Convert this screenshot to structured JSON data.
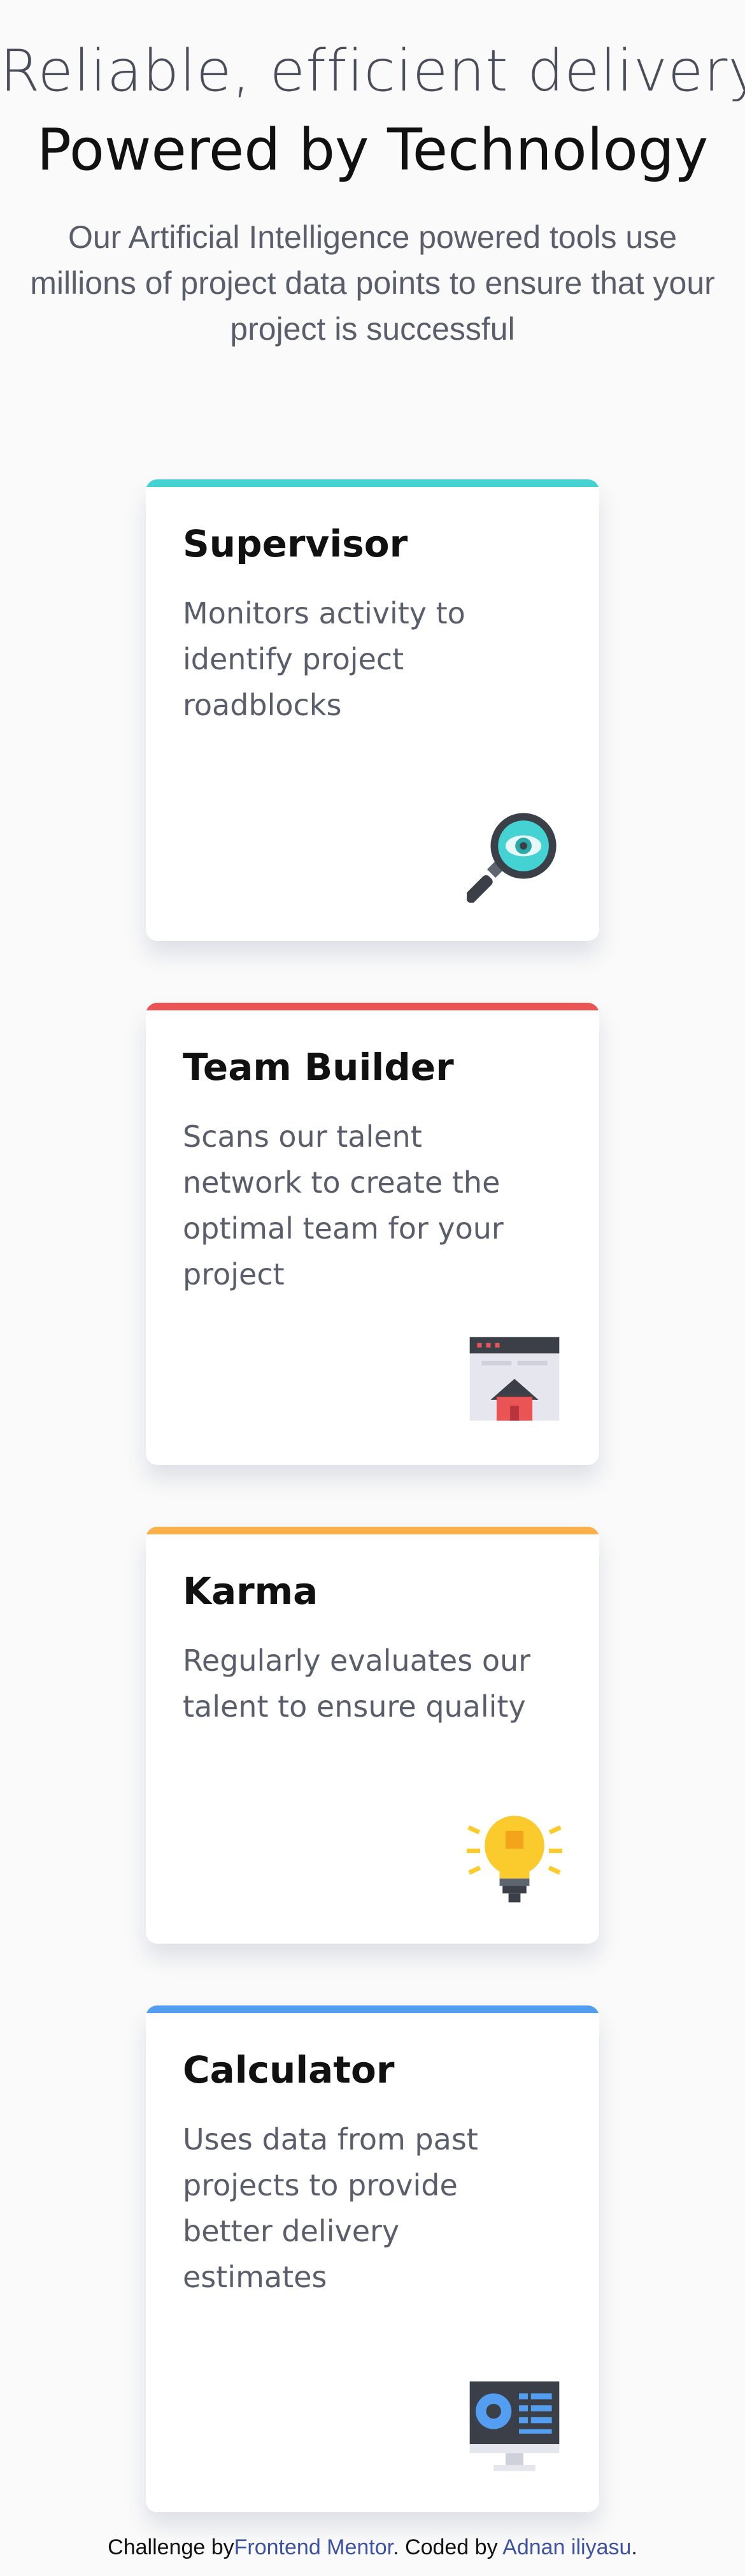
{
  "header": {
    "title_light": "Reliable, efficient delivery",
    "title_bold": "Powered by Technology",
    "intro": "Our Artificial Intelligence powered tools use millions of project data points to ensure that your project is successful"
  },
  "cards": [
    {
      "title": "Supervisor",
      "text": "Monitors activity to identify project roadblocks",
      "accent": "#44d3d2",
      "icon": "magnifier-eye-icon"
    },
    {
      "title": "Team Builder",
      "text": "Scans our talent network to create the optimal team for your project",
      "accent": "#ea5454",
      "icon": "browser-house-icon"
    },
    {
      "title": "Karma",
      "text": "Regularly evaluates our talent to ensure quality",
      "accent": "#fcaf4a",
      "icon": "lightbulb-icon"
    },
    {
      "title": "Calculator",
      "text": "Uses data from past projects to provide better delivery estimates",
      "accent": "#549ef2",
      "icon": "monitor-chart-icon"
    }
  ],
  "footer": {
    "prefix": "Challenge by",
    "link1": "Frontend Mentor",
    "middle": ". Coded by ",
    "link2": "Adnan iliyasu",
    "suffix": "."
  }
}
